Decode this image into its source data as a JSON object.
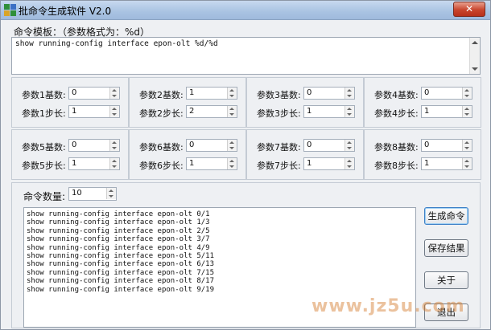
{
  "window": {
    "title": "批命令生成软件 V2.0",
    "close_label": "✕"
  },
  "template": {
    "label": "命令模板：（参数格式为：%d）",
    "value": "show running-config interface epon-olt %d/%d"
  },
  "params": [
    {
      "base_label": "参数1基数:",
      "base_value": "0",
      "step_label": "参数1步长:",
      "step_value": "1"
    },
    {
      "base_label": "参数2基数:",
      "base_value": "1",
      "step_label": "参数2步长:",
      "step_value": "2"
    },
    {
      "base_label": "参数3基数:",
      "base_value": "0",
      "step_label": "参数3步长:",
      "step_value": "1"
    },
    {
      "base_label": "参数4基数:",
      "base_value": "0",
      "step_label": "参数4步长:",
      "step_value": "1"
    },
    {
      "base_label": "参数5基数:",
      "base_value": "0",
      "step_label": "参数5步长:",
      "step_value": "1"
    },
    {
      "base_label": "参数6基数:",
      "base_value": "0",
      "step_label": "参数6步长:",
      "step_value": "1"
    },
    {
      "base_label": "参数7基数:",
      "base_value": "0",
      "step_label": "参数7步长:",
      "step_value": "1"
    },
    {
      "base_label": "参数8基数:",
      "base_value": "0",
      "step_label": "参数8步长:",
      "step_value": "1"
    }
  ],
  "count": {
    "label": "命令数量:",
    "value": "10"
  },
  "output": [
    "show running-config interface epon-olt 0/1",
    "show running-config interface epon-olt 1/3",
    "show running-config interface epon-olt 2/5",
    "show running-config interface epon-olt 3/7",
    "show running-config interface epon-olt 4/9",
    "show running-config interface epon-olt 5/11",
    "show running-config interface epon-olt 6/13",
    "show running-config interface epon-olt 7/15",
    "show running-config interface epon-olt 8/17",
    "show running-config interface epon-olt 9/19"
  ],
  "buttons": {
    "generate": "生成命令",
    "save": "保存结果",
    "about": "关于",
    "exit": "退出"
  },
  "watermark": "www.jz5u.com"
}
